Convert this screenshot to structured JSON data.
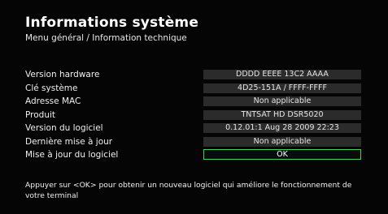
{
  "header": {
    "title": "Informations système",
    "breadcrumb": "Menu général / Information technique"
  },
  "info_rows": [
    {
      "label": "Version hardware",
      "value": "DDDD EEEE 13C2 AAAA"
    },
    {
      "label": "Clé système",
      "value": "4D25-151A / FFFF-FFFF"
    },
    {
      "label": "Adresse MAC",
      "value": "Non applicable"
    },
    {
      "label": "Produit",
      "value": "TNTSAT HD  DSR5020"
    },
    {
      "label": "Version du logiciel",
      "value": "0.12.01:1  Aug 28 2009 22:23"
    },
    {
      "label": "Dernière mise à jour",
      "value": "Non applicable"
    },
    {
      "label": "Mise à jour du logiciel",
      "value": "OK"
    }
  ],
  "help_text": "Appuyer sur <OK> pour obtenir un nouveau logiciel qui améliore le fonctionnement de votre terminal",
  "colors": {
    "focus_border": "#3fd060",
    "value_bg": "#2b2b2b"
  }
}
